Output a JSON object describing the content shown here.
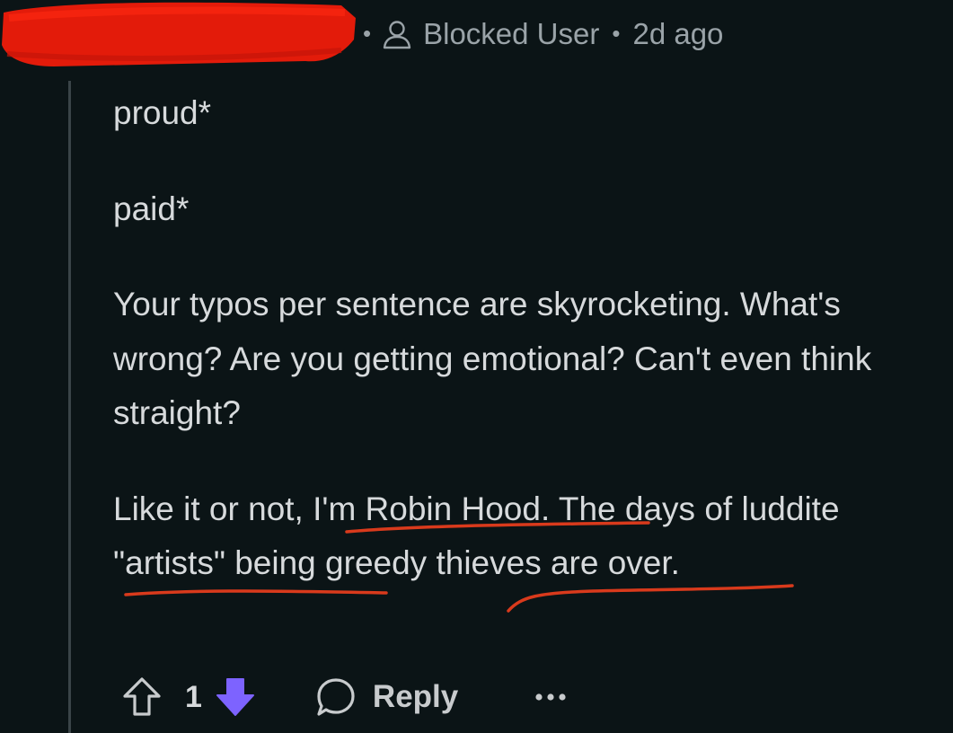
{
  "colors": {
    "background": "#0b1416",
    "text": "#d7dadc",
    "meta_text": "#9aa3a8",
    "downvote": "#7d63ff",
    "redaction": "#e31b0a",
    "underline": "#d93a1c"
  },
  "comment": {
    "author_redacted": true,
    "separator": "•",
    "user_icon": "user-outline-icon",
    "author_label": "Blocked User",
    "time_separator": "•",
    "timestamp": "2d ago",
    "paragraphs": [
      "proud*",
      "paid*",
      "Your typos per sentence are skyrocketing. What's wrong? Are you getting emotional? Can't even think straight?"
    ],
    "last_paragraph": {
      "part1": "Like it or not, ",
      "underline1": "I'm Robin Hood.",
      "part2": " The days of ",
      "underline2": "luddite \"artists\"",
      "part3": " being ",
      "underline3": "greedy thieves are",
      "part4": " over."
    }
  },
  "actions": {
    "upvote_icon": "upvote-arrow-icon",
    "score": "1",
    "downvote_icon": "downvote-arrow-icon",
    "reply_icon": "speech-bubble-icon",
    "reply_label": "Reply",
    "more_icon": "ellipsis-icon"
  }
}
